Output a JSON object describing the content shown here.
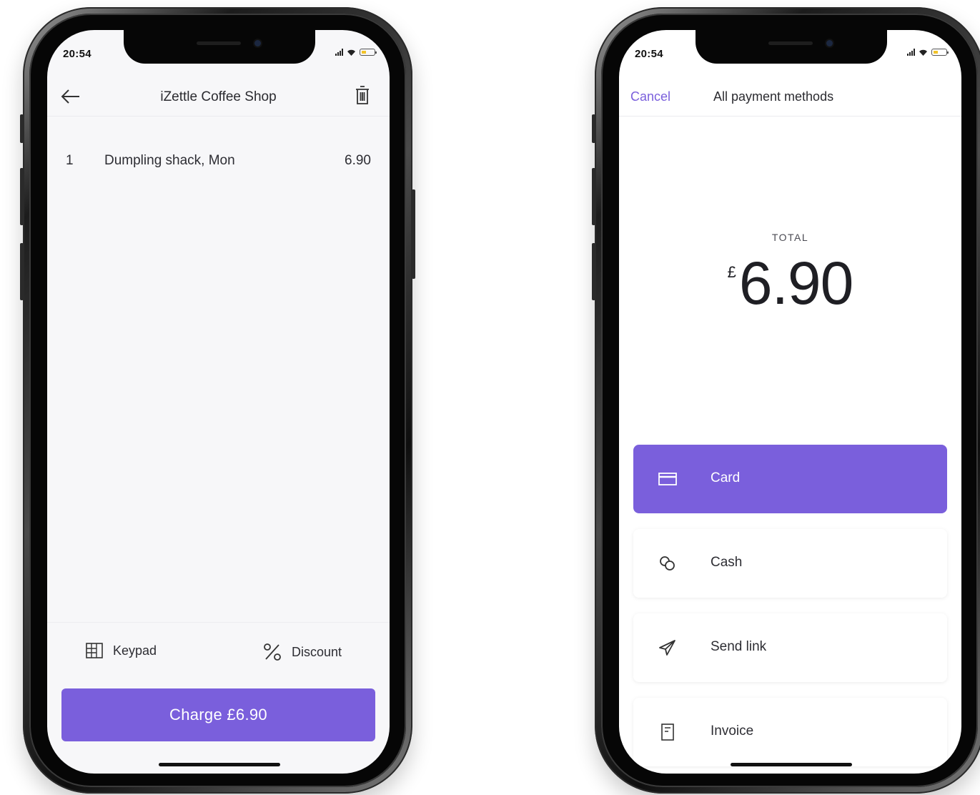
{
  "colors": {
    "accent": "#7a5fdc",
    "screen_bg": "#f7f7f9",
    "text": "#2d2d33"
  },
  "left": {
    "status": {
      "time": "20:54"
    },
    "header": {
      "title": "iZettle Coffee Shop",
      "back_icon": "arrow-left-icon",
      "delete_icon": "trash-icon"
    },
    "items": [
      {
        "qty": "1",
        "name": "Dumpling shack, Mon",
        "price": "6.90"
      }
    ],
    "actions": {
      "keypad_label": "Keypad",
      "keypad_icon": "keypad-icon",
      "discount_label": "Discount",
      "discount_icon": "percent-icon"
    },
    "charge_label": "Charge £6.90"
  },
  "right": {
    "status": {
      "time": "20:54"
    },
    "header": {
      "cancel_label": "Cancel",
      "title": "All payment methods"
    },
    "total": {
      "label": "TOTAL",
      "currency": "£",
      "amount": "6.90"
    },
    "methods": [
      {
        "label": "Card",
        "icon": "credit-card-icon",
        "selected": true
      },
      {
        "label": "Cash",
        "icon": "coins-icon",
        "selected": false
      },
      {
        "label": "Send link",
        "icon": "paper-plane-icon",
        "selected": false
      },
      {
        "label": "Invoice",
        "icon": "invoice-icon",
        "selected": false
      }
    ]
  }
}
